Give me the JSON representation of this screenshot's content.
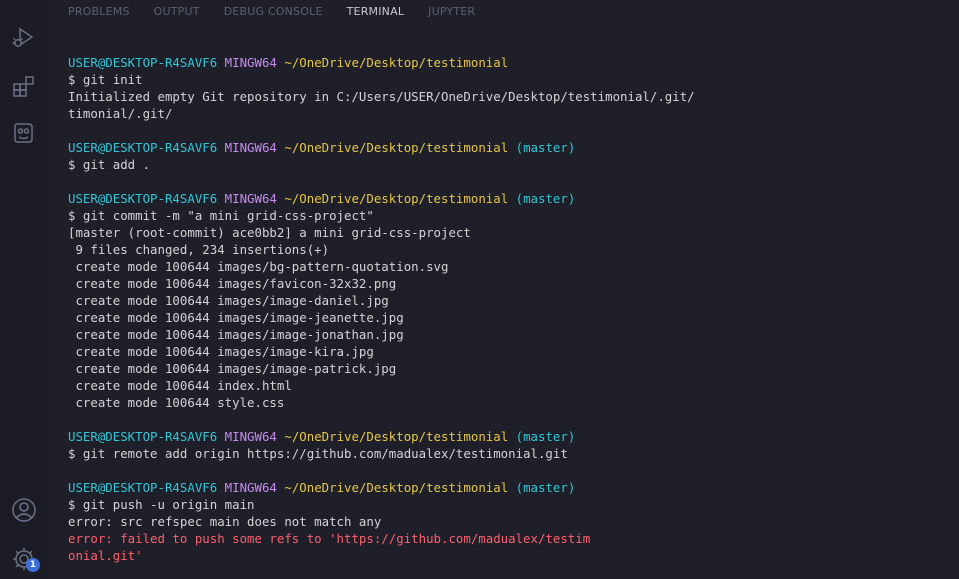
{
  "panel": {
    "tabs": [
      {
        "label": "PROBLEMS",
        "active": false
      },
      {
        "label": "OUTPUT",
        "active": false
      },
      {
        "label": "DEBUG CONSOLE",
        "active": false
      },
      {
        "label": "TERMINAL",
        "active": true
      },
      {
        "label": "JUPYTER",
        "active": false
      }
    ]
  },
  "activity_bar": {
    "icons": [
      "run-debug-icon",
      "extensions-icon",
      "remote-icon",
      "account-icon",
      "settings-gear-icon"
    ],
    "settings_badge": "1"
  },
  "terminal": {
    "prompt": {
      "user": "USER@DESKTOP-R4SAVF6",
      "shell": "MINGW64",
      "path": "~/OneDrive/Desktop/testimonial",
      "branch": "(master)"
    },
    "blocks": [
      {
        "branch": false,
        "command": "$ git init",
        "output": [
          {
            "text": "Initialized empty Git repository in C:/Users/USER/OneDrive/Desktop/testimonial/.git/",
            "error": false
          },
          {
            "text": "timonial/.git/",
            "error": false
          }
        ]
      },
      {
        "branch": true,
        "command": "$ git add .",
        "output": []
      },
      {
        "branch": true,
        "command": "$ git commit -m \"a mini grid-css-project\"",
        "output": [
          {
            "text": "[master (root-commit) ace0bb2] a mini grid-css-project",
            "error": false
          },
          {
            "text": " 9 files changed, 234 insertions(+)",
            "error": false
          },
          {
            "text": " create mode 100644 images/bg-pattern-quotation.svg",
            "error": false
          },
          {
            "text": " create mode 100644 images/favicon-32x32.png",
            "error": false
          },
          {
            "text": " create mode 100644 images/image-daniel.jpg",
            "error": false
          },
          {
            "text": " create mode 100644 images/image-jeanette.jpg",
            "error": false
          },
          {
            "text": " create mode 100644 images/image-jonathan.jpg",
            "error": false
          },
          {
            "text": " create mode 100644 images/image-kira.jpg",
            "error": false
          },
          {
            "text": " create mode 100644 images/image-patrick.jpg",
            "error": false
          },
          {
            "text": " create mode 100644 index.html",
            "error": false
          },
          {
            "text": " create mode 100644 style.css",
            "error": false
          }
        ]
      },
      {
        "branch": true,
        "command": "$ git remote add origin https://github.com/madualex/testimonial.git",
        "output": []
      },
      {
        "branch": true,
        "command": "$ git push -u origin main",
        "output": [
          {
            "text": "error: src refspec main does not match any",
            "error": false
          },
          {
            "text": "error: failed to push some refs to 'https://github.com/madualex/testim",
            "error": true
          },
          {
            "text": "onial.git'",
            "error": true
          }
        ]
      }
    ]
  },
  "colors": {
    "background": "#1e1f29",
    "user": "#33c5d5",
    "shell": "#c58bef",
    "path": "#e6c54b",
    "error": "#ff5f6d",
    "badge": "#3d6fd8"
  }
}
